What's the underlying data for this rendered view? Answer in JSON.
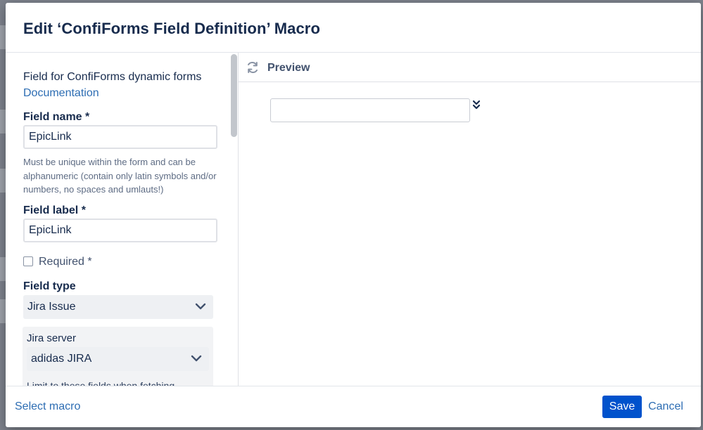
{
  "dialog": {
    "title": "Edit ‘ConfiForms Field Definition’ Macro"
  },
  "form": {
    "intro": "Field for ConfiForms dynamic forms",
    "documentation_link": "Documentation",
    "field_name": {
      "label": "Field name *",
      "value": "EpicLink",
      "help": "Must be unique within the form and can be alphanumeric (contain only latin symbols and/or numbers, no spaces and umlauts!)"
    },
    "field_label": {
      "label": "Field label *",
      "value": "EpicLink"
    },
    "required": {
      "label": "Required *",
      "checked": false
    },
    "field_type": {
      "label": "Field type",
      "value": "Jira Issue"
    },
    "jira_server": {
      "label": "Jira server",
      "value": "adidas JIRA"
    },
    "cut_off_text": "Limit to these fields when fetching"
  },
  "preview": {
    "title": "Preview",
    "icons": {
      "refresh": "refresh-icon",
      "toggle": "double-chevron-down-icon"
    }
  },
  "footer": {
    "select_macro": "Select macro",
    "save": "Save",
    "cancel": "Cancel"
  },
  "colors": {
    "primary": "#0052cc",
    "link": "#2d6db3",
    "heading": "#172b4d",
    "overlay": "#7d828c"
  }
}
